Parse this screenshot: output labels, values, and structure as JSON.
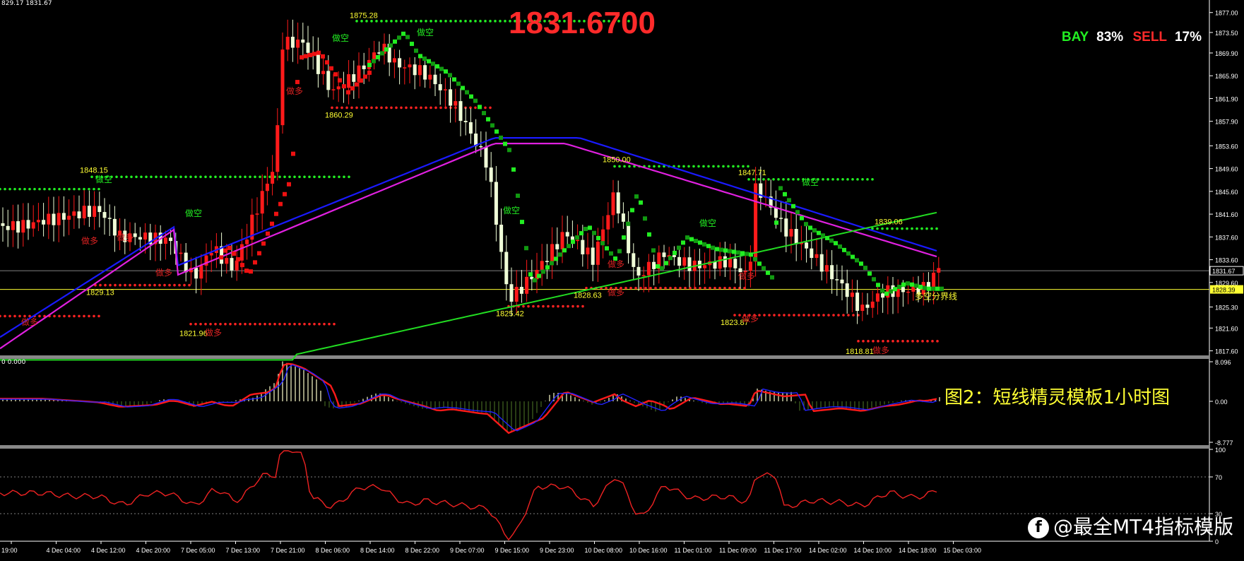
{
  "header": {
    "info_text": "829.17 1831.67",
    "big_price": "1831.6700",
    "bay_label": "BAY",
    "bay_value": "83%",
    "sell_label": "SELL",
    "sell_value": "17%"
  },
  "colors": {
    "bull_candle": "#ff1a1a",
    "bear_candle": "#f0ffd8",
    "ma_blue": "#1a1aff",
    "ma_magenta": "#e020e0",
    "ma_green": "#22dd22",
    "support_dots": "#ff2222",
    "resistance_dots": "#22ee22",
    "title_yellow": "#ffff33"
  },
  "price_axis": {
    "ticks": [
      "1877.00",
      "1873.50",
      "1869.90",
      "1865.90",
      "1861.90",
      "1857.90",
      "1853.60",
      "1849.60",
      "1845.60",
      "1841.60",
      "1837.60",
      "1833.60",
      "1829.60",
      "1825.30",
      "1821.60",
      "1817.60"
    ],
    "current_price": "1831.67",
    "yellow_line_price": "1828.39"
  },
  "price_annotations": {
    "highs": [
      "1875.28",
      "1848.15",
      "1850.00",
      "1847.71",
      "1839.06"
    ],
    "lows": [
      "1829.13",
      "1821.96",
      "1860.29",
      "1825.42",
      "1828.63",
      "1823.87",
      "1818.81"
    ]
  },
  "signal_labels": {
    "short": "做空",
    "long": "做多",
    "split_line": "多空分界线",
    "short_chars": [
      "做空",
      "做空",
      "做空",
      "做空",
      "做空",
      "做空",
      "做空"
    ],
    "long_chars": [
      "做多",
      "做多",
      "做多",
      "做多",
      "做多",
      "做多",
      "做多",
      "做多",
      "做多",
      "做多",
      "做多"
    ]
  },
  "macd_panel": {
    "info_text": "0 0.000",
    "ticks": [
      "8.096",
      "0.00",
      "-8.777"
    ]
  },
  "rsi_panel": {
    "ticks": [
      "100",
      "70",
      "30",
      "0"
    ]
  },
  "time_axis": {
    "labels": [
      "19:00",
      "4 Dec 04:00",
      "4 Dec 12:00",
      "4 Dec 20:00",
      "7 Dec 05:00",
      "7 Dec 13:00",
      "7 Dec 21:00",
      "8 Dec 06:00",
      "8 Dec 14:00",
      "8 Dec 22:00",
      "9 Dec 07:00",
      "9 Dec 15:00",
      "9 Dec 23:00",
      "10 Dec 08:00",
      "10 Dec 16:00",
      "11 Dec 01:00",
      "11 Dec 09:00",
      "11 Dec 17:00",
      "14 Dec 02:00",
      "14 Dec 10:00",
      "14 Dec 18:00",
      "15 Dec 03:00"
    ]
  },
  "overlay": {
    "caption": "图2：短线精灵模板1小时图",
    "watermark": "@最全MT4指标模版",
    "watermark_icon": "f"
  }
}
